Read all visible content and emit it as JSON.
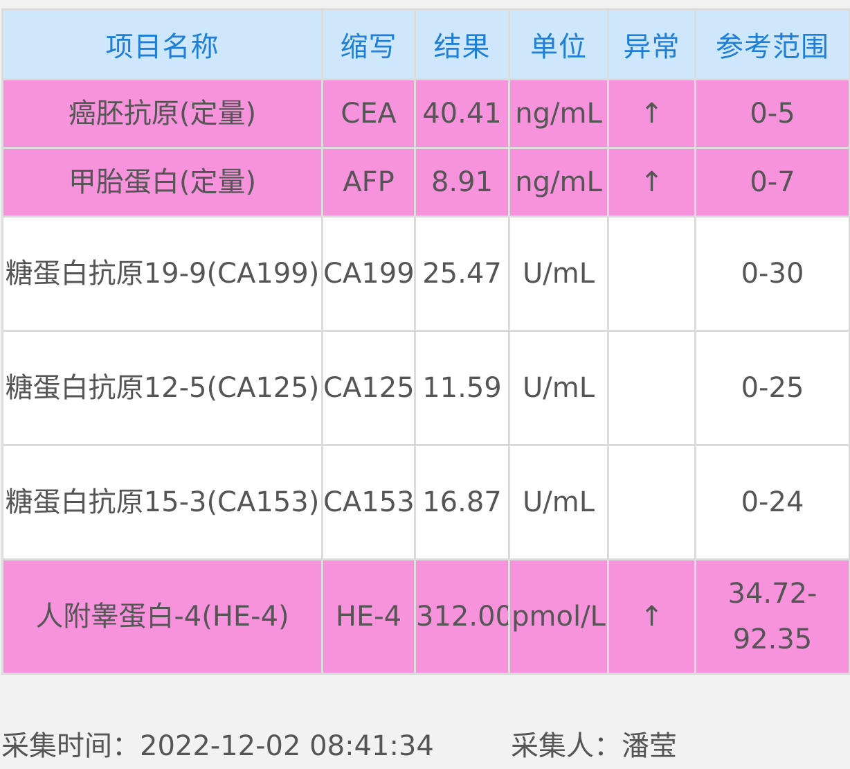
{
  "table": {
    "headers": {
      "name": "项目名称",
      "abbr": "缩写",
      "result": "结果",
      "unit": "单位",
      "abnormal": "异常",
      "range": "参考范围"
    },
    "rows": [
      {
        "name": "癌胚抗原(定量)",
        "abbr": "CEA",
        "result": "40.41",
        "unit": "ng/mL",
        "flag": "↑",
        "range": "0-5",
        "abnormal": true
      },
      {
        "name": "甲胎蛋白(定量)",
        "abbr": "AFP",
        "result": "8.91",
        "unit": "ng/mL",
        "flag": "↑",
        "range": "0-7",
        "abnormal": true
      },
      {
        "name": "糖蛋白抗原19-9(CA199)",
        "abbr": "CA199",
        "result": "25.47",
        "unit": "U/mL",
        "flag": "",
        "range": "0-30",
        "abnormal": false
      },
      {
        "name": "糖蛋白抗原12-5(CA125)",
        "abbr": "CA125",
        "result": "11.59",
        "unit": "U/mL",
        "flag": "",
        "range": "0-25",
        "abnormal": false
      },
      {
        "name": "糖蛋白抗原15-3(CA153)",
        "abbr": "CA153",
        "result": "16.87",
        "unit": "U/mL",
        "flag": "",
        "range": "0-24",
        "abnormal": false
      },
      {
        "name": "人附睾蛋白-4(HE-4)",
        "abbr": "HE-4",
        "result": "312.00",
        "unit": "pmol/L",
        "flag": "↑",
        "range": "34.72-92.35",
        "abnormal": true
      }
    ]
  },
  "footer": {
    "collect_time": "采集时间：2022-12-02 08:41:34",
    "collector": "采集人：潘莹"
  },
  "colors": {
    "header_bg": "#cfe7fb",
    "header_text": "#1f7fd6",
    "abnormal_bg": "#f693dc",
    "normal_bg": "#ffffff",
    "text": "#555555",
    "page_bg": "#f2f2f2"
  }
}
